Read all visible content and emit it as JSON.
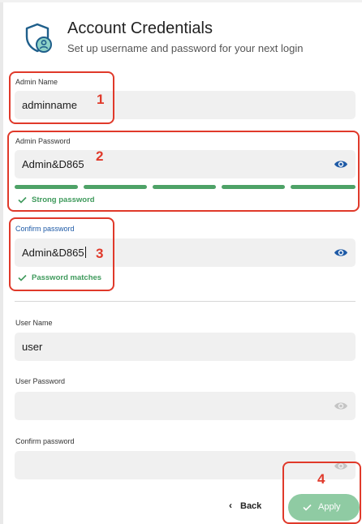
{
  "header": {
    "title": "Account Credentials",
    "subtitle": "Set up username and password for your next login",
    "icon": "shield-user-icon"
  },
  "admin_name": {
    "label": "Admin Name",
    "value": "adminname"
  },
  "admin_password": {
    "label": "Admin Password",
    "value": "Admin&D865",
    "strength_segments_filled": 5,
    "strength_segments_total": 5,
    "status": "Strong password"
  },
  "admin_confirm": {
    "label": "Confirm password",
    "value": "Admin&D865",
    "status": "Password matches"
  },
  "user_name": {
    "label": "User Name",
    "value": "user"
  },
  "user_password": {
    "label": "User Password",
    "value": ""
  },
  "user_confirm": {
    "label": "Confirm password",
    "value": ""
  },
  "footer": {
    "back_label": "Back",
    "apply_label": "Apply"
  },
  "annotations": [
    "1",
    "2",
    "3",
    "4"
  ],
  "colors": {
    "accent_green": "#4ea267",
    "apply_green": "#8fcba3",
    "eye_blue": "#1e5aa6",
    "annotation_red": "#e0392a"
  }
}
